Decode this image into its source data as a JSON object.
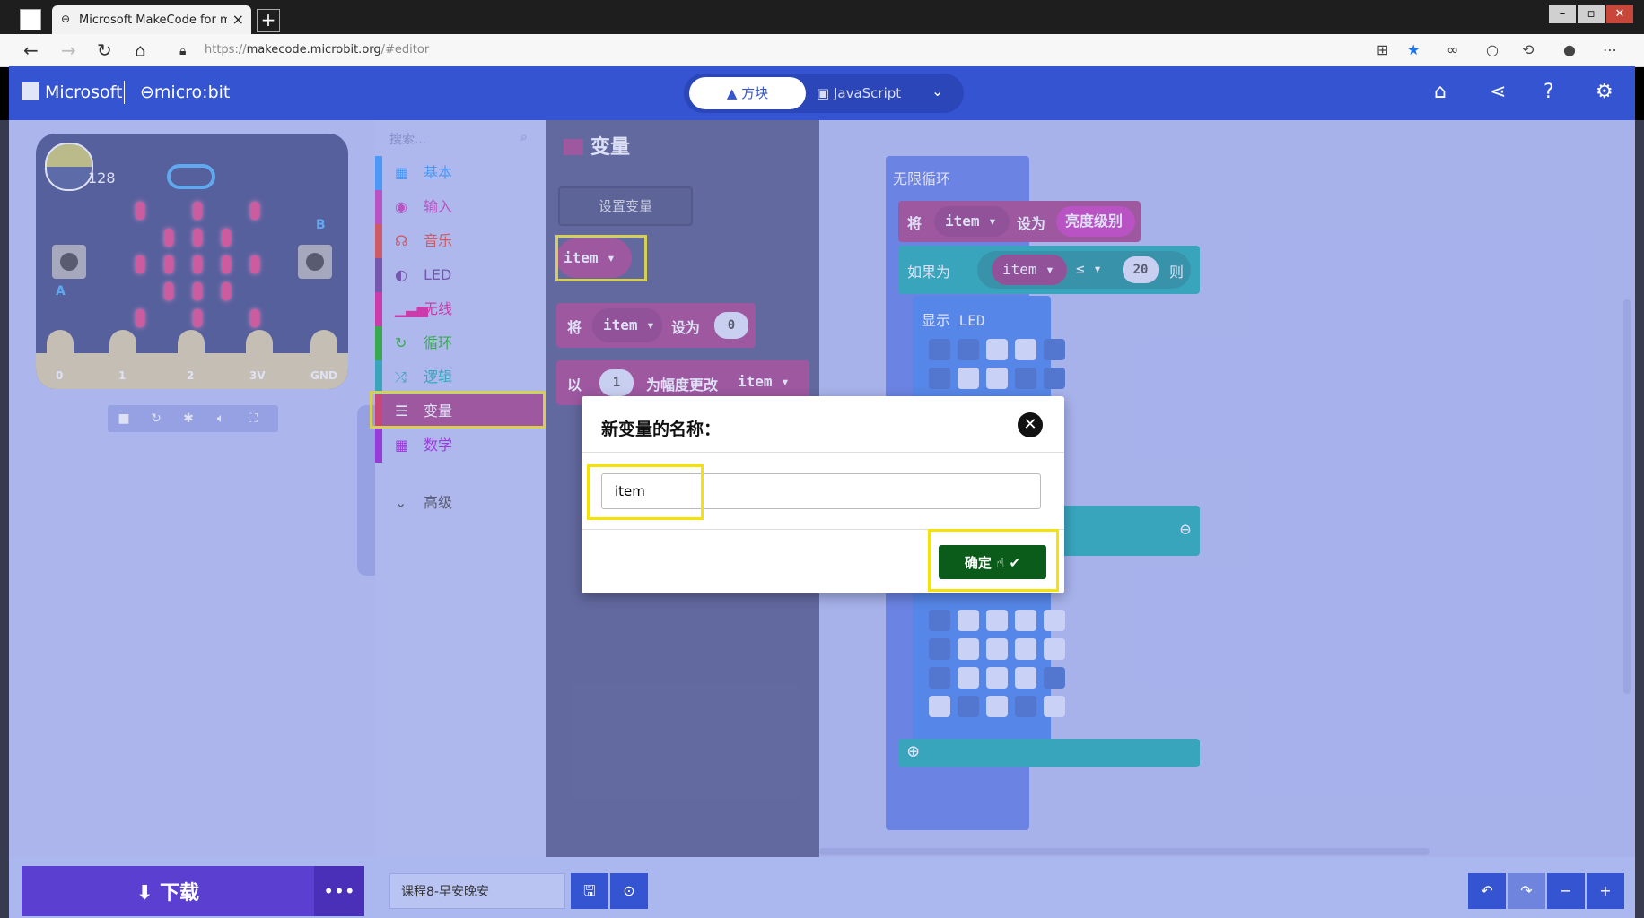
{
  "browser": {
    "tab_title": "Microsoft MakeCode for micro:b",
    "url_prefix": "https://",
    "url_host": "makecode.microbit.org",
    "url_path": "/#editor"
  },
  "header": {
    "microsoft": "Microsoft",
    "product": "micro:bit",
    "tab_blocks": "方块",
    "tab_js": "JavaScript"
  },
  "simulator": {
    "light_level": "128",
    "button_a": "A",
    "button_b": "B",
    "pins": [
      "0",
      "1",
      "2",
      "3V",
      "GND"
    ]
  },
  "toolbox": {
    "search_placeholder": "搜索...",
    "categories": [
      {
        "label": "基本",
        "color": "#1e90ff",
        "icon": "grid-icon"
      },
      {
        "label": "输入",
        "color": "#c724b1",
        "icon": "target-icon"
      },
      {
        "label": "音乐",
        "color": "#e63022",
        "icon": "headphones-icon"
      },
      {
        "label": "LED",
        "color": "#5c2d91",
        "icon": "toggle-icon"
      },
      {
        "label": "无线",
        "color": "#e3008c",
        "icon": "signal-icon"
      },
      {
        "label": "循环",
        "color": "#00aa00",
        "icon": "refresh-icon"
      },
      {
        "label": "逻辑",
        "color": "#00a4a6",
        "icon": "shuffle-icon"
      },
      {
        "label": "变量",
        "color": "#dc143c",
        "icon": "list-icon"
      },
      {
        "label": "数学",
        "color": "#9400d3",
        "icon": "calculator-icon"
      }
    ],
    "advanced": "高级"
  },
  "flyout": {
    "title": "变量",
    "make_variable": "设置变量",
    "var_item": "item",
    "set_label_1": "将",
    "set_label_2": "设为",
    "set_value": "0",
    "change_label_1": "以",
    "change_value": "1",
    "change_label_2": "为幅度更改"
  },
  "workspace": {
    "forever": "无限循环",
    "set_1": "将",
    "set_var": "item",
    "set_2": "设为",
    "light_level": "亮度级别",
    "if_label": "如果为",
    "if_var": "item",
    "op": "≤",
    "if_value": "20",
    "then": "则",
    "show_leds": "显示 LED"
  },
  "dialog": {
    "title": "新变量的名称：",
    "input_value": "item",
    "ok_label": "确定"
  },
  "bottom": {
    "download": "下载",
    "project_name": "课程8-早安晚安"
  }
}
